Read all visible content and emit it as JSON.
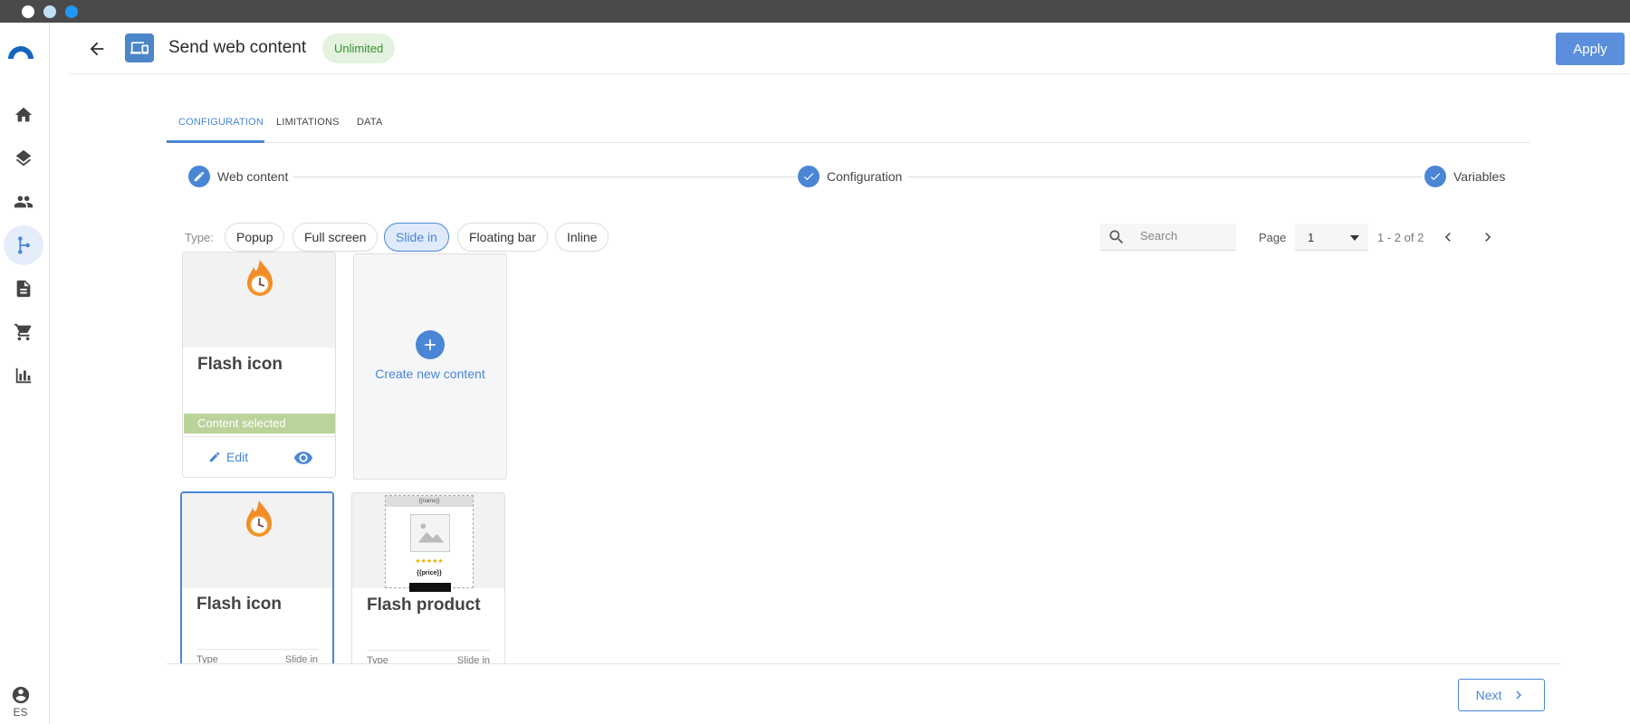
{
  "sidebar": {
    "language": "ES",
    "items": [
      {
        "name": "home-icon"
      },
      {
        "name": "layers-icon"
      },
      {
        "name": "people-icon"
      },
      {
        "name": "workflow-icon",
        "active": true
      },
      {
        "name": "document-icon"
      },
      {
        "name": "cart-icon"
      },
      {
        "name": "chart-icon"
      }
    ]
  },
  "header": {
    "title": "Send web content",
    "badge": "Unlimited",
    "apply_label": "Apply"
  },
  "tabs": [
    {
      "label": "CONFIGURATION",
      "active": true
    },
    {
      "label": "LIMITATIONS"
    },
    {
      "label": "DATA"
    }
  ],
  "stepper": [
    {
      "label": "Web content",
      "icon": "pencil-icon"
    },
    {
      "label": "Configuration",
      "icon": "check-icon"
    },
    {
      "label": "Variables",
      "icon": "check-icon"
    }
  ],
  "filters": {
    "type_label": "Type:",
    "chips": [
      {
        "label": "Popup"
      },
      {
        "label": "Full screen"
      },
      {
        "label": "Slide in",
        "selected": true
      },
      {
        "label": "Floating bar"
      },
      {
        "label": "Inline"
      }
    ],
    "search_placeholder": "Search",
    "page_label": "Page",
    "page_value": "1",
    "page_range": "1 - 2 of 2"
  },
  "cards": {
    "first": {
      "title": "Flash icon",
      "selected_label": "Content selected",
      "edit_label": "Edit"
    },
    "new_content_label": "Create new content",
    "second": {
      "title": "Flash icon",
      "meta_label": "Type",
      "meta_value": "Slide in"
    },
    "third": {
      "title": "Flash product",
      "meta_label": "Type",
      "meta_value": "Slide in",
      "thumb_name": "{{name}}",
      "thumb_price": "{{price}}",
      "thumb_stars": "★★★★★"
    }
  },
  "footer": {
    "next_label": "Next"
  },
  "colors": {
    "accent": "#4a86d6",
    "badge_bg": "#e3f3df",
    "selected_bar": "#b9d39a"
  }
}
